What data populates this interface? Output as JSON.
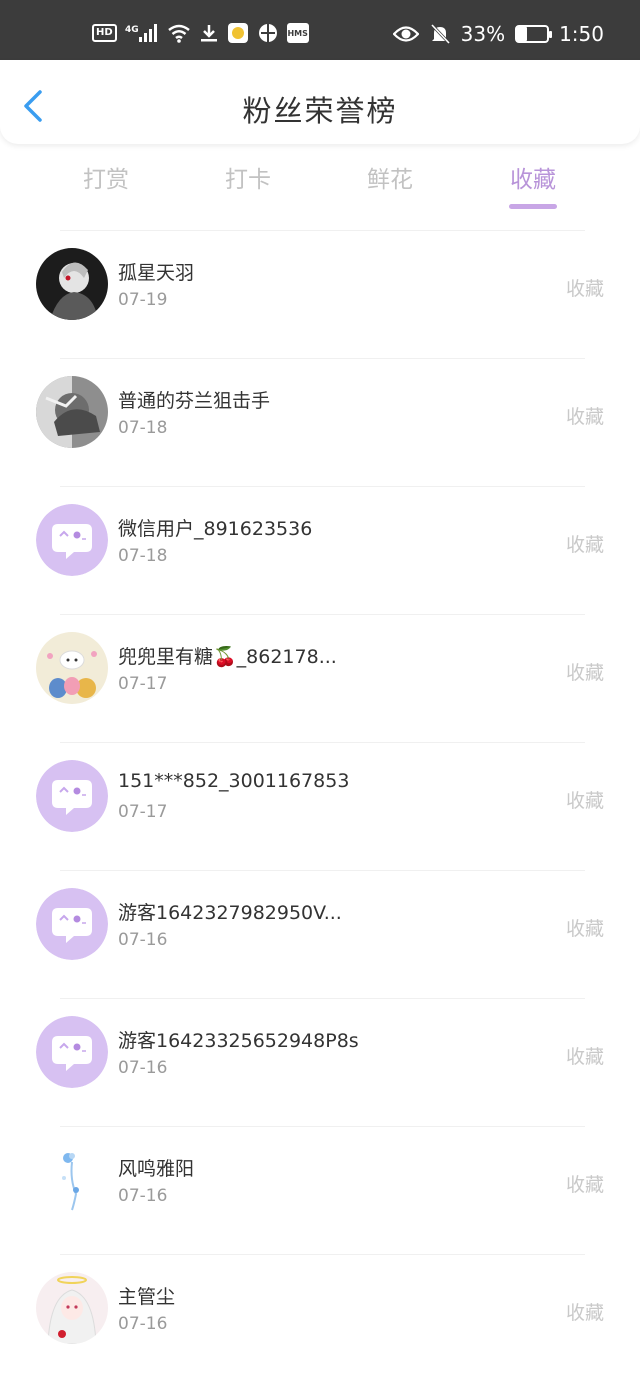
{
  "status_bar": {
    "left_icons": [
      "HD",
      "4G",
      "signal-icon",
      "wifi-icon",
      "download-icon",
      "app-icon",
      "vpn-icon",
      "HMS"
    ],
    "right": {
      "battery_percent": "33%",
      "time": "1:50",
      "battery_level": 0.33
    }
  },
  "header": {
    "title": "粉丝荣誉榜"
  },
  "tabs": [
    {
      "label": "打赏"
    },
    {
      "label": "打卡"
    },
    {
      "label": "鲜花"
    },
    {
      "label": "收藏",
      "active": true
    }
  ],
  "colors": {
    "accent": "#b894d9",
    "avatar_default": "#d7c1f2"
  },
  "list": [
    {
      "name": "孤星天羽",
      "date": "07-19",
      "action": "收藏",
      "avatar": "photo-dark"
    },
    {
      "name": "普通的芬兰狙击手",
      "date": "07-18",
      "action": "收藏",
      "avatar": "photo-gray"
    },
    {
      "name": "微信用户_891623536",
      "date": "07-18",
      "action": "收藏",
      "avatar": "default-chat"
    },
    {
      "name": "兜兜里有糖🍒_862178...",
      "date": "07-17",
      "action": "收藏",
      "avatar": "photo-cartoon"
    },
    {
      "name": "151***852_3001167853",
      "date": "07-17",
      "action": "收藏",
      "avatar": "default-chat"
    },
    {
      "name": "游客1642327982950V...",
      "date": "07-16",
      "action": "收藏",
      "avatar": "default-chat"
    },
    {
      "name": "游客16423325652948P8s",
      "date": "07-16",
      "action": "收藏",
      "avatar": "default-chat"
    },
    {
      "name": "风鸣雅阳",
      "date": "07-16",
      "action": "收藏",
      "avatar": "photo-flower"
    },
    {
      "name": "主管尘",
      "date": "07-16",
      "action": "收藏",
      "avatar": "photo-anime"
    }
  ]
}
